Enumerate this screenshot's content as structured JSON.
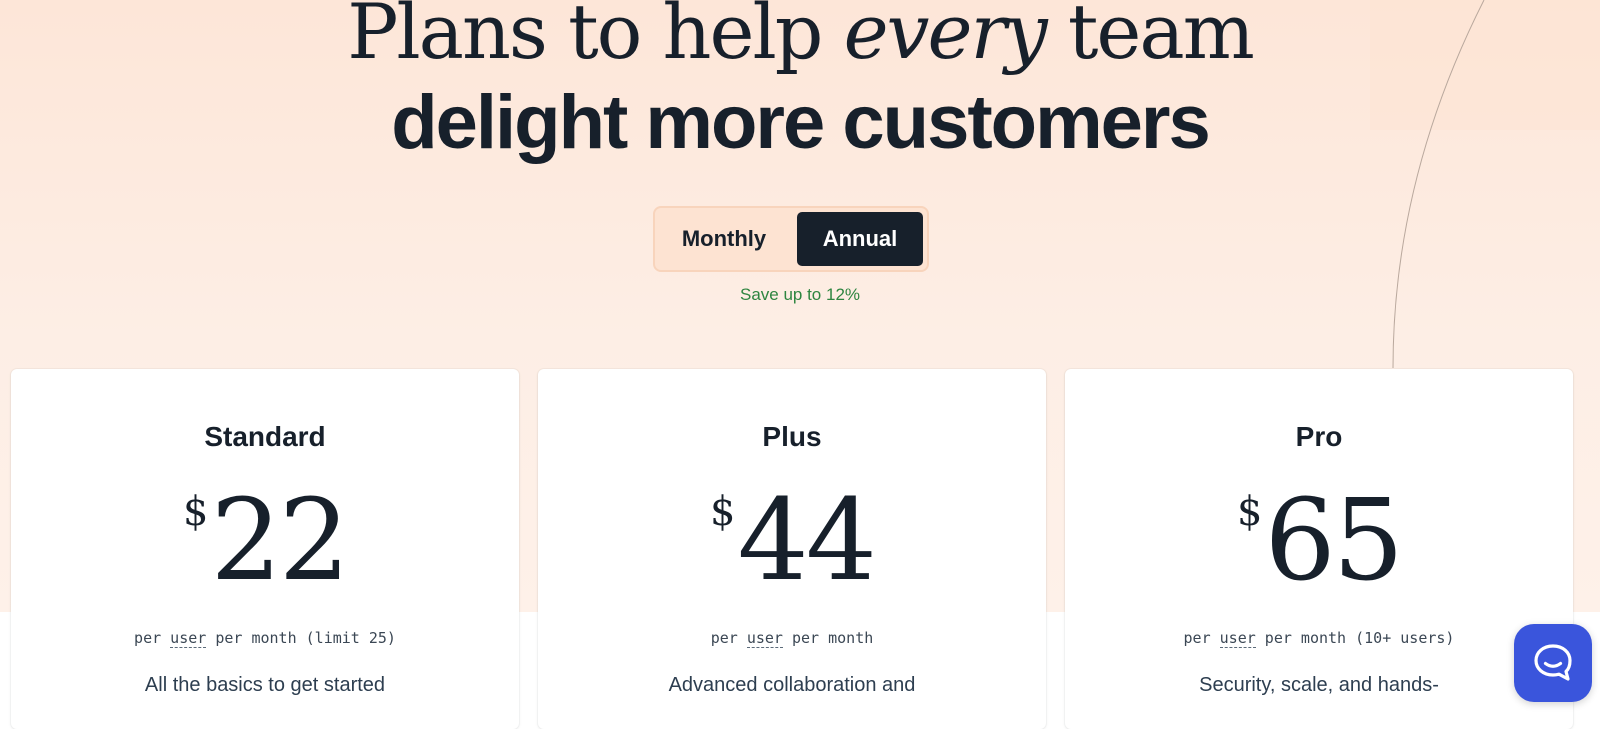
{
  "headline": {
    "line1_before": "Plans to help ",
    "line1_emphasis": "every",
    "line1_after": " team",
    "line2": "delight more customers"
  },
  "billing_toggle": {
    "options": [
      "Monthly",
      "Annual"
    ],
    "selected": "Annual",
    "savings_note": "Save up to 12%"
  },
  "plans": [
    {
      "name": "Standard",
      "currency": "$",
      "price": "22",
      "billing_before": "per ",
      "billing_unit": "user",
      "billing_after": " per month (limit 25)",
      "description": "All the basics to get started"
    },
    {
      "name": "Plus",
      "currency": "$",
      "price": "44",
      "billing_before": "per ",
      "billing_unit": "user",
      "billing_after": " per month",
      "description": "Advanced collaboration and"
    },
    {
      "name": "Pro",
      "currency": "$",
      "price": "65",
      "billing_before": "per ",
      "billing_unit": "user",
      "billing_after": " per month (10+ users)",
      "description": "Security, scale, and hands-"
    }
  ],
  "chat_widget": {
    "icon": "chat-bubble-icon"
  },
  "colors": {
    "page_background": "#fdeee5",
    "text_dark": "#17202b",
    "toggle_background": "#fde3d2",
    "toggle_selected": "#17202b",
    "savings_green": "#2e8540",
    "chat_launcher": "#3a55dc"
  }
}
